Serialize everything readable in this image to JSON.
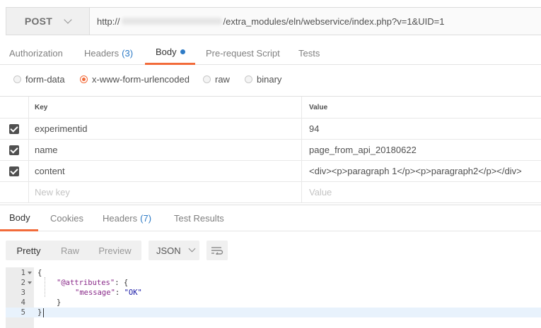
{
  "request": {
    "method": "POST",
    "url_prefix": "http://",
    "url_suffix": "/extra_modules/eln/webservice/index.php?v=1&UID=1"
  },
  "request_tabs": [
    {
      "label": "Authorization"
    },
    {
      "label": "Headers",
      "count": "(3)"
    },
    {
      "label": "Body"
    },
    {
      "label": "Pre-request Script"
    },
    {
      "label": "Tests"
    }
  ],
  "body_types": [
    {
      "label": "form-data",
      "selected": false
    },
    {
      "label": "x-www-form-urlencoded",
      "selected": true
    },
    {
      "label": "raw",
      "selected": false
    },
    {
      "label": "binary",
      "selected": false
    }
  ],
  "params_table": {
    "headers": {
      "key": "Key",
      "value": "Value"
    },
    "rows": [
      {
        "key": "experimentid",
        "value": "94",
        "checked": true
      },
      {
        "key": "name",
        "value": "page_from_api_20180622",
        "checked": true
      },
      {
        "key": "content",
        "value": "<div><p>paragraph 1</p><p>paragraph2</p></div>",
        "checked": true
      }
    ],
    "new_key_placeholder": "New key",
    "new_value_placeholder": "Value"
  },
  "response_tabs": [
    {
      "label": "Body"
    },
    {
      "label": "Cookies"
    },
    {
      "label": "Headers",
      "count": "(7)"
    },
    {
      "label": "Test Results"
    }
  ],
  "format_buttons": {
    "pretty": "Pretty",
    "raw": "Raw",
    "preview": "Preview"
  },
  "language": "JSON",
  "code": {
    "line_numbers": [
      "1",
      "2",
      "3",
      "4",
      "5"
    ],
    "l1": "{",
    "l2_key": "\"@attributes\"",
    "l2_rest": ": {",
    "l3_key": "\"message\"",
    "l3_colon": ": ",
    "l3_val": "\"OK\"",
    "l4": "}",
    "l5": "}"
  },
  "colors": {
    "accent": "#f26b3a",
    "link_blue": "#2e7bc6"
  }
}
